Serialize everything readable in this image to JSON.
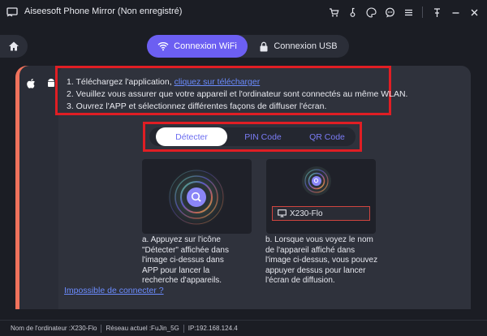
{
  "app": {
    "title": "Aiseesoft Phone Mirror (Non enregistré)"
  },
  "titlebar_icons": [
    "cart-icon",
    "key-icon",
    "palette-icon",
    "chat-icon",
    "menu-icon",
    "pin-icon",
    "minimize-icon",
    "close-icon"
  ],
  "connection_tabs": {
    "wifi_label": "Connexion WiFi",
    "usb_label": "Connexion USB"
  },
  "steps": {
    "step1_prefix": "1. Téléchargez l'application, ",
    "step1_link": "cliquez sur télécharger",
    "step2": "2. Veuillez vous assurer que votre appareil et l'ordinateur sont connectés au même WLAN.",
    "step3": "3. Ouvrez l'APP et sélectionnez différentes façons de diffuser l'écran."
  },
  "modes": {
    "detect": "Détecter",
    "pin": "PIN Code",
    "qr": "QR Code"
  },
  "cards": {
    "detect_desc": "a. Appuyez sur l'icône \"Détecter\" affichée dans l'image ci-dessus dans APP pour lancer la recherche d'appareils.",
    "device_name": "X230-Flo",
    "device_desc": "b. Lorsque vous voyez le nom de l'appareil affiché dans l'image ci-dessus, vous pouvez appuyer dessus pour lancer l'écran de diffusion."
  },
  "cant_connect": "Impossible de connecter ?",
  "statusbar": {
    "computer": "Nom de l'ordinateur :X230-Flo",
    "network": "Réseau actuel :FuJin_5G",
    "ip": "IP:192.168.124.4"
  },
  "colors": {
    "accent": "#6c5ff2",
    "link": "#6b8cff",
    "highlight_border": "#e01e24",
    "strip_red": "#f0725c",
    "strip_green": "#5ee08a"
  }
}
